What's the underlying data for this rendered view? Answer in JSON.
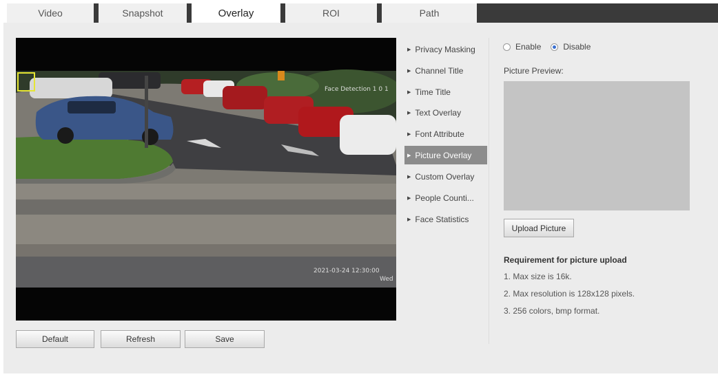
{
  "tabs": [
    {
      "label": "Video",
      "active": false
    },
    {
      "label": "Snapshot",
      "active": false
    },
    {
      "label": "Overlay",
      "active": true
    },
    {
      "label": "ROI",
      "active": false
    },
    {
      "label": "Path",
      "active": false
    }
  ],
  "video": {
    "overlay_title": "Face Detection 1 0 1",
    "overlay_timestamp": "2021-03-24 12:30:00",
    "overlay_sub": "Wed"
  },
  "buttons": {
    "default": "Default",
    "refresh": "Refresh",
    "save": "Save"
  },
  "menu": [
    {
      "label": "Privacy Masking",
      "active": false
    },
    {
      "label": "Channel Title",
      "active": false
    },
    {
      "label": "Time Title",
      "active": false
    },
    {
      "label": "Text Overlay",
      "active": false
    },
    {
      "label": "Font Attribute",
      "active": false
    },
    {
      "label": "Picture Overlay",
      "active": true
    },
    {
      "label": "Custom Overlay",
      "active": false
    },
    {
      "label": "People Counti...",
      "active": false
    },
    {
      "label": "Face Statistics",
      "active": false
    }
  ],
  "picture_overlay": {
    "enable_label": "Enable",
    "disable_label": "Disable",
    "selected": "disable",
    "preview_label": "Picture Preview:",
    "upload_button": "Upload Picture",
    "requirement_title": "Requirement for picture upload",
    "requirements": [
      "1. Max size is 16k.",
      "2. Max resolution is 128x128 pixels.",
      "3. 256 colors, bmp format."
    ]
  },
  "colors": {
    "tab_bar": "#3a3a3a",
    "active_menu": "#8c8c8c",
    "panel_bg": "#ececec",
    "radio_accent": "#3a6fd0"
  }
}
